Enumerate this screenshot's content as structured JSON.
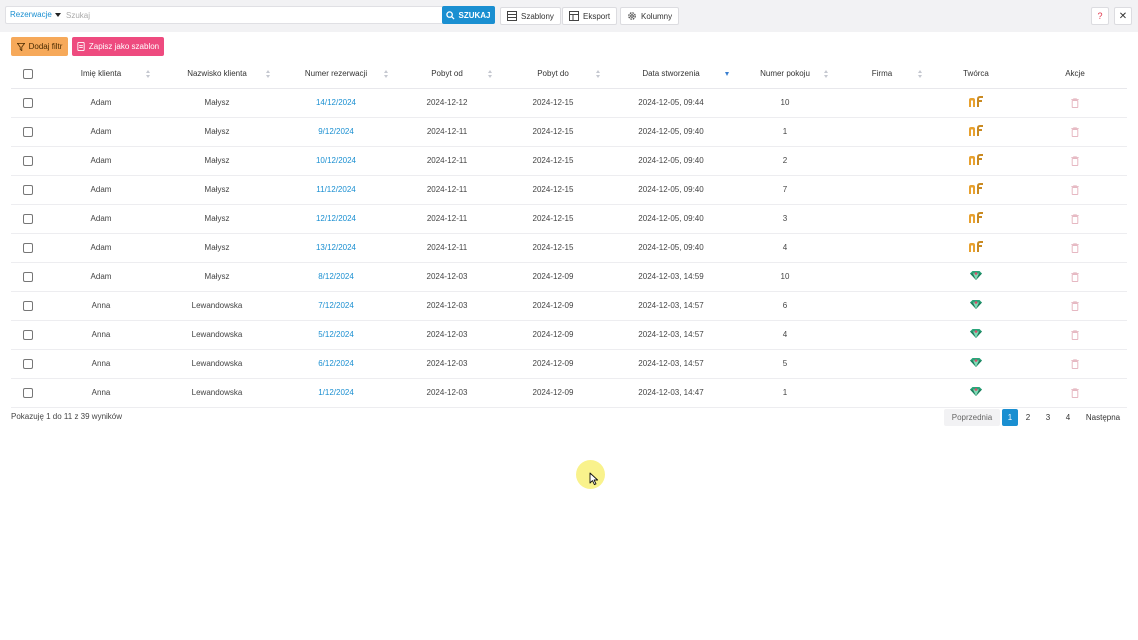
{
  "toolbar": {
    "scope_label": "Rezerwacje",
    "search_placeholder": "Szukaj",
    "search_value": "",
    "search_button": "SZUKAJ",
    "templates_button": "Szablony",
    "export_button": "Eksport",
    "columns_button": "Kolumny",
    "help_label": "?",
    "close_label": "✕"
  },
  "actions": {
    "add_filter": "Dodaj filtr",
    "save_template": "Zapisz jako szablon"
  },
  "table": {
    "columns": [
      "Imię klienta",
      "Nazwisko klienta",
      "Numer rezerwacji",
      "Pobyt od",
      "Pobyt do",
      "Data stworzenia",
      "Numer pokoju",
      "Firma",
      "Twórca",
      "Akcje"
    ],
    "rows": [
      {
        "first": "Adam",
        "last": "Małysz",
        "number": "14/12/2024",
        "from": "2024-12-12",
        "to": "2024-12-15",
        "created": "2024-12-05, 09:44",
        "room": "10",
        "company": "",
        "creator": "nf-logo"
      },
      {
        "first": "Adam",
        "last": "Małysz",
        "number": "9/12/2024",
        "from": "2024-12-11",
        "to": "2024-12-15",
        "created": "2024-12-05, 09:40",
        "room": "1",
        "company": "",
        "creator": "nf-logo"
      },
      {
        "first": "Adam",
        "last": "Małysz",
        "number": "10/12/2024",
        "from": "2024-12-11",
        "to": "2024-12-15",
        "created": "2024-12-05, 09:40",
        "room": "2",
        "company": "",
        "creator": "nf-logo"
      },
      {
        "first": "Adam",
        "last": "Małysz",
        "number": "11/12/2024",
        "from": "2024-12-11",
        "to": "2024-12-15",
        "created": "2024-12-05, 09:40",
        "room": "7",
        "company": "",
        "creator": "nf-logo"
      },
      {
        "first": "Adam",
        "last": "Małysz",
        "number": "12/12/2024",
        "from": "2024-12-11",
        "to": "2024-12-15",
        "created": "2024-12-05, 09:40",
        "room": "3",
        "company": "",
        "creator": "nf-logo"
      },
      {
        "first": "Adam",
        "last": "Małysz",
        "number": "13/12/2024",
        "from": "2024-12-11",
        "to": "2024-12-15",
        "created": "2024-12-05, 09:40",
        "room": "4",
        "company": "",
        "creator": "nf-logo"
      },
      {
        "first": "Adam",
        "last": "Małysz",
        "number": "8/12/2024",
        "from": "2024-12-03",
        "to": "2024-12-09",
        "created": "2024-12-03, 14:59",
        "room": "10",
        "company": "",
        "creator": "gem-icon"
      },
      {
        "first": "Anna",
        "last": "Lewandowska",
        "number": "7/12/2024",
        "from": "2024-12-03",
        "to": "2024-12-09",
        "created": "2024-12-03, 14:57",
        "room": "6",
        "company": "",
        "creator": "gem-icon"
      },
      {
        "first": "Anna",
        "last": "Lewandowska",
        "number": "5/12/2024",
        "from": "2024-12-03",
        "to": "2024-12-09",
        "created": "2024-12-03, 14:57",
        "room": "4",
        "company": "",
        "creator": "gem-icon"
      },
      {
        "first": "Anna",
        "last": "Lewandowska",
        "number": "6/12/2024",
        "from": "2024-12-03",
        "to": "2024-12-09",
        "created": "2024-12-03, 14:57",
        "room": "5",
        "company": "",
        "creator": "gem-icon"
      },
      {
        "first": "Anna",
        "last": "Lewandowska",
        "number": "1/12/2024",
        "from": "2024-12-03",
        "to": "2024-12-09",
        "created": "2024-12-03, 14:47",
        "room": "1",
        "company": "",
        "creator": "gem-icon"
      }
    ]
  },
  "footer": {
    "summary": "Pokazuję 1 do 11 z 39 wyników",
    "prev": "Poprzednia",
    "pages": [
      "1",
      "2",
      "3",
      "4"
    ],
    "next": "Następna"
  },
  "colors": {
    "accent": "#1a8fd1",
    "filter_button": "#f6a95a",
    "template_button": "#ee4b7f",
    "nf_logo": "#e8a12f",
    "gem": "#2aa57a"
  }
}
